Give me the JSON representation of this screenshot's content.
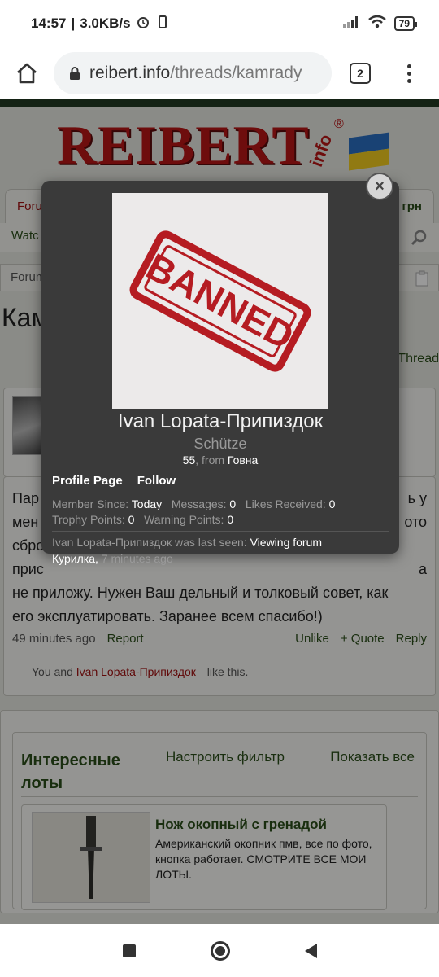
{
  "status_bar": {
    "time": "14:57",
    "speed": "3.0KB/s",
    "battery": "79",
    "icons": [
      "alarm-icon",
      "vibrate-icon",
      "signal-icon",
      "wifi-icon",
      "battery-icon"
    ]
  },
  "browser": {
    "url_domain": "reibert.info",
    "url_path": "/threads/kamrady",
    "tab_count": "2"
  },
  "site": {
    "logo_text": "REIBERT",
    "logo_info": "info",
    "logo_reg": "®",
    "tab_left": "Foru",
    "tab_right": "грн",
    "subnav_left": "Watc",
    "crumb": "Forum",
    "thread_title": "Кам",
    "thread_link": "Thread"
  },
  "post": {
    "text_lines": [
      "Пар",
      "мен",
      "сбро",
      "прис",
      "не приложу. Нужен Ваш дельный и толковый совет, как",
      "его эксплуатировать. Заранее всем спасибо!)"
    ],
    "right_fragments": [
      "ь у",
      "ото",
      "",
      "а"
    ],
    "time": "49 minutes ago",
    "report": "Report",
    "unlike": "Unlike",
    "quote": "+ Quote",
    "reply": "Reply",
    "likes_prefix": "You and",
    "likes_user": "Ivan Lopata-Припиздок",
    "likes_suffix": "like this."
  },
  "lots": {
    "title": "Интересные лоты",
    "filter": "Настроить фильтр",
    "show_all": "Показать все",
    "item_name": "Нож окопный с гренадой",
    "item_desc": "Американский окопник пмв, все по фото, кнопка работает. СМОТРИТЕ ВСЕ МОИ ЛОТЫ."
  },
  "popup": {
    "avatar_text": "BANNED",
    "name": "Ivan Lopata-Припиздок",
    "user_title": "Schütze",
    "age": "55",
    "from_label": ", from",
    "location": "Говна",
    "profile_page": "Profile Page",
    "follow": "Follow",
    "member_since_label": "Member Since:",
    "member_since": "Today",
    "messages_label": "Messages:",
    "messages": "0",
    "likes_label": "Likes Received:",
    "likes": "0",
    "trophy_label": "Trophy Points:",
    "trophy": "0",
    "warning_label": "Warning Points:",
    "warning": "0",
    "last_seen_prefix": "Ivan Lopata-Припиздок was last seen:",
    "last_seen_action": "Viewing forum",
    "last_seen_forum": "Курилка,",
    "last_seen_time": "7 minutes ago",
    "close": "×"
  },
  "colors": {
    "brand_red": "#b81616",
    "forum_green": "#2b4e1a",
    "popup_bg": "#3a3a3a"
  }
}
